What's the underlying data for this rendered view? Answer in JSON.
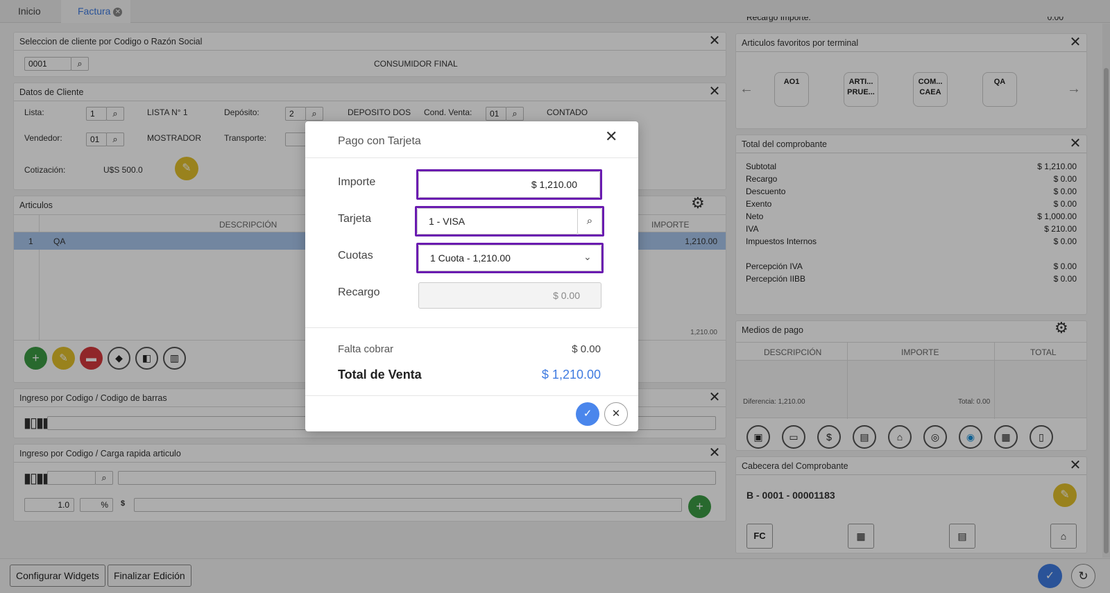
{
  "tabs": [
    {
      "label": "Inicio"
    },
    {
      "label": "Factura"
    }
  ],
  "cliente_panel": {
    "title": "Seleccion de cliente por Codigo o Razón Social",
    "code": "0001",
    "name": "CONSUMIDOR FINAL"
  },
  "datos_cliente": {
    "title": "Datos de Cliente",
    "lista_label": "Lista:",
    "lista_value": "1",
    "lista_name": "LISTA N° 1",
    "deposito_label": "Depósito:",
    "deposito_value": "2",
    "deposito_name": "DEPOSITO DOS",
    "cond_label": "Cond. Venta:",
    "cond_value": "01",
    "cond_name": "CONTADO",
    "vendedor_label": "Vendedor:",
    "vendedor_value": "01",
    "vendedor_name": "MOSTRADOR",
    "transporte_label": "Transporte:",
    "cotizacion_label": "Cotización:",
    "cotizacion_value": "U$S 500.0"
  },
  "articulos": {
    "title": "Articulos",
    "col_descripcion": "DESCRIPCIÓN",
    "col_importe": "IMPORTE",
    "rows": [
      {
        "num": "1",
        "desc": "QA",
        "importe": "1,210.00"
      }
    ],
    "footer_total": "1,210.00"
  },
  "ingreso_barras": {
    "title": "Ingreso por Codigo / Codigo de barras"
  },
  "ingreso_rapido": {
    "title": "Ingreso por Codigo / Carga rapida articulo",
    "qty": "1.0",
    "pct": "%",
    "currency": "$"
  },
  "recargo_partial": "Recargo Importe:",
  "recargo_partial_value": "0.00",
  "favoritos": {
    "title": "Articulos favoritos por terminal",
    "items": [
      "AO1",
      "ARTI... PRUE...",
      "COM... CAEA",
      "QA"
    ]
  },
  "totales": {
    "title": "Total del comprobante",
    "rows": [
      {
        "label": "Subtotal",
        "value": "$ 1,210.00"
      },
      {
        "label": "Recargo",
        "value": "$ 0.00"
      },
      {
        "label": "Descuento",
        "value": "$ 0.00"
      },
      {
        "label": "Exento",
        "value": "$ 0.00"
      },
      {
        "label": "Neto",
        "value": "$ 1,000.00"
      },
      {
        "label": "IVA",
        "value": "$ 210.00"
      },
      {
        "label": "Impuestos Internos",
        "value": "$ 0.00"
      },
      {
        "label": "Percepción IVA",
        "value": "$ 0.00"
      },
      {
        "label": "Percepción IIBB",
        "value": "$ 0.00"
      }
    ]
  },
  "medios": {
    "title": "Medios de pago",
    "col_desc": "DESCRIPCIÓN",
    "col_importe": "IMPORTE",
    "col_total": "TOTAL",
    "diferencia": "Diferencia: 1,210.00",
    "total": "Total: 0.00"
  },
  "cabecera": {
    "title": "Cabecera del Comprobante",
    "numero": "B - 0001 - 00001183",
    "fc": "FC"
  },
  "bottom": {
    "configurar": "Configurar Widgets",
    "finalizar": "Finalizar Edición"
  },
  "modal": {
    "title": "Pago con Tarjeta",
    "importe_label": "Importe",
    "importe_value": "$ 1,210.00",
    "tarjeta_label": "Tarjeta",
    "tarjeta_value": "1 - VISA",
    "cuotas_label": "Cuotas",
    "cuotas_value": "1 Cuota - 1,210.00",
    "recargo_label": "Recargo",
    "recargo_value": "$ 0.00",
    "falta_label": "Falta cobrar",
    "falta_value": "$ 0.00",
    "total_label": "Total de Venta",
    "total_value": "$ 1,210.00"
  },
  "colors": {
    "accent": "#3f7be0",
    "highlight": "#6a1bb0",
    "green": "#3c9b45",
    "yellow": "#e2c02c",
    "red": "#d5393d",
    "selected_row": "#a8c6ec"
  }
}
